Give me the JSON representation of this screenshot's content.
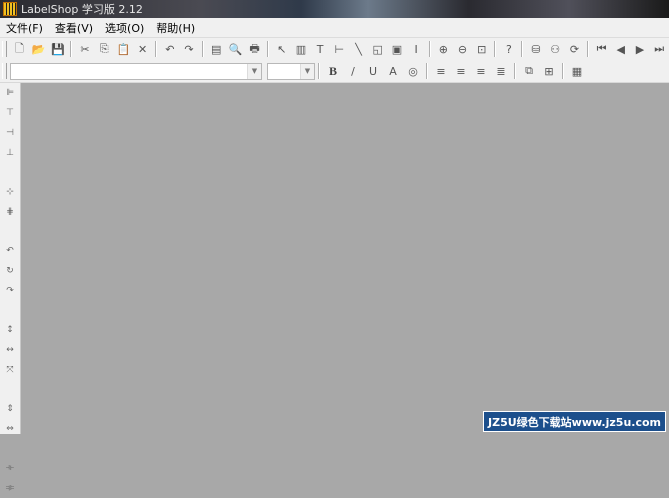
{
  "window": {
    "title": "LabelShop 学习版 2.12"
  },
  "menu": [
    "文件(F)",
    "查看(V)",
    "选项(O)",
    "帮助(H)"
  ],
  "toolbar1": [
    {
      "icon": "new-doc-icon",
      "glyph": "🗋"
    },
    {
      "icon": "open-folder-icon",
      "glyph": "📂"
    },
    {
      "icon": "save-icon",
      "glyph": "💾"
    },
    {
      "sep": true
    },
    {
      "icon": "cut-icon",
      "glyph": "✂"
    },
    {
      "icon": "copy-icon",
      "glyph": "⎘"
    },
    {
      "icon": "paste-icon",
      "glyph": "📋"
    },
    {
      "icon": "delete-icon",
      "glyph": "✕"
    },
    {
      "sep": true
    },
    {
      "icon": "undo-icon",
      "glyph": "↶"
    },
    {
      "icon": "redo-icon",
      "glyph": "↷"
    },
    {
      "sep": true
    },
    {
      "icon": "page-setup-icon",
      "glyph": "▤"
    },
    {
      "icon": "print-preview-icon",
      "glyph": "🔍"
    },
    {
      "icon": "print-icon",
      "glyph": "🖶"
    },
    {
      "sep": true
    },
    {
      "icon": "select-pointer-icon",
      "glyph": "↖"
    },
    {
      "icon": "barcode-icon",
      "glyph": "▥"
    },
    {
      "icon": "text-icon",
      "glyph": "T"
    },
    {
      "icon": "hline-icon",
      "glyph": "⊢"
    },
    {
      "icon": "line-icon",
      "glyph": "╲"
    },
    {
      "icon": "shape-icon",
      "glyph": "◱"
    },
    {
      "icon": "image-icon",
      "glyph": "▣"
    },
    {
      "icon": "vline-icon",
      "glyph": "I"
    },
    {
      "sep": true
    },
    {
      "icon": "zoom-in-icon",
      "glyph": "⊕"
    },
    {
      "icon": "zoom-out-icon",
      "glyph": "⊖"
    },
    {
      "icon": "zoom-fit-icon",
      "glyph": "⊡"
    },
    {
      "sep": true
    },
    {
      "icon": "help-icon",
      "glyph": "?"
    },
    {
      "sep": true
    },
    {
      "icon": "database-icon",
      "glyph": "⛁"
    },
    {
      "icon": "find-icon",
      "glyph": "⚇"
    },
    {
      "icon": "refresh-icon",
      "glyph": "⟳"
    },
    {
      "sep": true
    },
    {
      "icon": "first-record-icon",
      "glyph": "⏮"
    },
    {
      "icon": "prev-record-icon",
      "glyph": "◀"
    },
    {
      "icon": "next-record-icon",
      "glyph": "▶"
    },
    {
      "icon": "last-record-icon",
      "glyph": "⏭"
    }
  ],
  "toolbar2": [
    {
      "icon": "bold-icon",
      "glyph": "B",
      "bold": true
    },
    {
      "icon": "italic-icon",
      "glyph": "/"
    },
    {
      "icon": "underline-icon",
      "glyph": "U"
    },
    {
      "icon": "text-color-icon",
      "glyph": "A"
    },
    {
      "icon": "color-palette-icon",
      "glyph": "◎"
    },
    {
      "sep": true
    },
    {
      "icon": "align-left-icon",
      "glyph": "≡"
    },
    {
      "icon": "align-center-icon",
      "glyph": "≡"
    },
    {
      "icon": "align-right-icon",
      "glyph": "≡"
    },
    {
      "icon": "align-justify-icon",
      "glyph": "≣"
    },
    {
      "sep": true
    },
    {
      "icon": "group-icon",
      "glyph": "⧉"
    },
    {
      "icon": "ungroup-icon",
      "glyph": "⊞"
    },
    {
      "sep": true
    },
    {
      "icon": "properties-icon",
      "glyph": "▦"
    }
  ],
  "sidebar": [
    {
      "icon": "align-left-edge-icon",
      "glyph": "⊫"
    },
    {
      "icon": "align-top-edge-icon",
      "glyph": "⊤"
    },
    {
      "icon": "align-right-edge-icon",
      "glyph": "⊣"
    },
    {
      "icon": "align-bottom-edge-icon",
      "glyph": "⊥"
    },
    {
      "sep": true
    },
    {
      "icon": "center-horizontal-icon",
      "glyph": "⊹"
    },
    {
      "icon": "center-vertical-icon",
      "glyph": "⋕"
    },
    {
      "sep": true
    },
    {
      "icon": "rotate-90-icon",
      "glyph": "↶"
    },
    {
      "icon": "rotate-180-icon",
      "glyph": "↻"
    },
    {
      "icon": "rotate-270-icon",
      "glyph": "↷"
    },
    {
      "sep": true
    },
    {
      "icon": "same-height-icon",
      "glyph": "↕"
    },
    {
      "icon": "same-width-icon",
      "glyph": "↔"
    },
    {
      "icon": "same-size-icon",
      "glyph": "⤧"
    },
    {
      "sep": true
    },
    {
      "icon": "space-vertical-icon",
      "glyph": "⇕"
    },
    {
      "icon": "space-horizontal-icon",
      "glyph": "⇔"
    },
    {
      "sep": true
    },
    {
      "icon": "distribute-horizontal-icon",
      "glyph": "⟛"
    },
    {
      "icon": "distribute-vertical-icon",
      "glyph": "⟚"
    }
  ],
  "watermark": "JZ5U绿色下载站www.jz5u.com"
}
